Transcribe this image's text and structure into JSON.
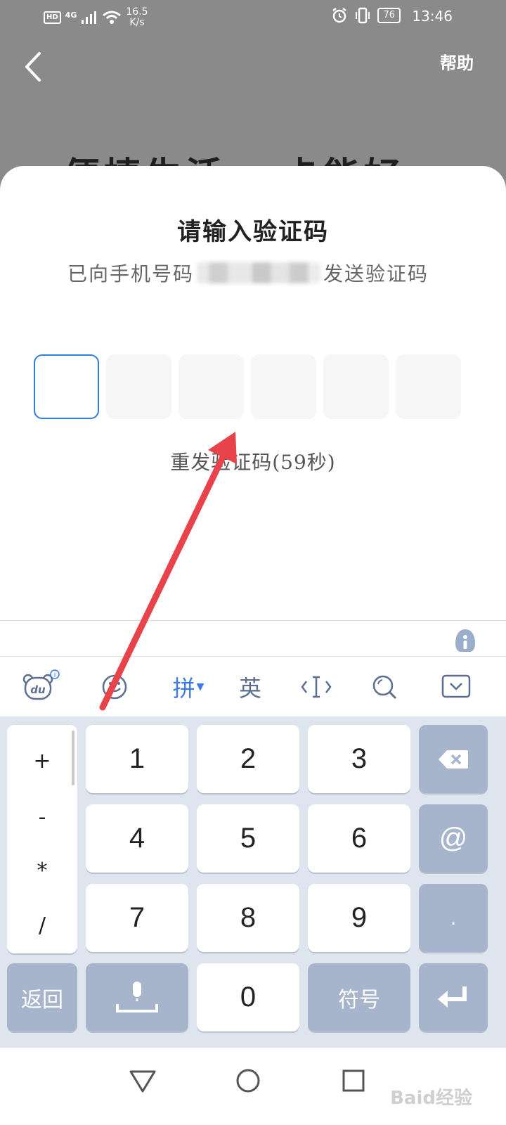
{
  "status_bar": {
    "hd_badge": "HD",
    "network": "4G",
    "speed_value": "16.5",
    "speed_unit": "K/s",
    "battery": "76",
    "time": "13:46"
  },
  "top_bar": {
    "help_label": "帮助"
  },
  "background": {
    "title_left": "便捷生活",
    "title_right": "卡能好"
  },
  "sheet": {
    "title": "请输入验证码",
    "subtitle_prefix": "已向手机号码",
    "subtitle_suffix": "发送验证码",
    "code_boxes": 6,
    "resend_label": "重发验证码(59秒)"
  },
  "keyboard": {
    "toolbar": {
      "du_label": "du",
      "pinyin_label": "拼",
      "english_label": "英"
    },
    "symbols": [
      "+",
      "-",
      "*",
      "/"
    ],
    "digits": [
      "1",
      "2",
      "3",
      "4",
      "5",
      "6",
      "7",
      "8",
      "9",
      "0"
    ],
    "at_key": "@",
    "dot_key": ".",
    "return_label": "返回",
    "symbol_label": "符号"
  },
  "watermark": "Baid经验",
  "colors": {
    "accent_blue": "#2f7de1",
    "arrow_red": "#e8424a",
    "function_key": "#a6b4cc",
    "keypad_bg": "#dfe5ef"
  },
  "icons": [
    "back-arrow-icon",
    "alarm-icon",
    "vibrate-icon",
    "wifi-icon",
    "signal-icon",
    "emoji-icon",
    "cursor-icon",
    "search-icon",
    "collapse-keyboard-icon",
    "backspace-icon",
    "microphone-icon",
    "enter-icon",
    "nav-back-icon",
    "nav-home-icon",
    "nav-recent-icon"
  ]
}
